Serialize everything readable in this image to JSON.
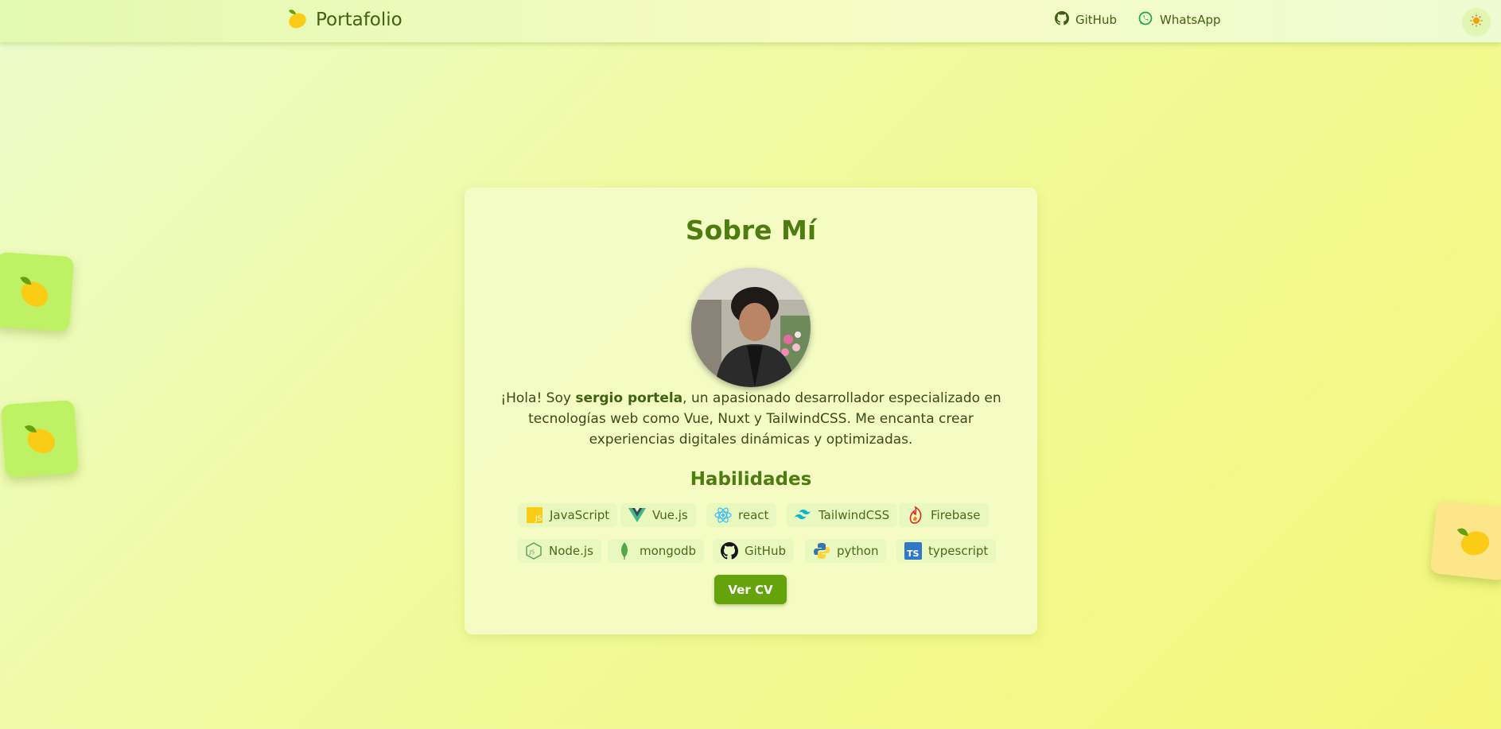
{
  "header": {
    "brand": "Portafolio",
    "brand_icon": "lemon-icon",
    "links": [
      {
        "label": "GitHub",
        "icon": "github-icon"
      },
      {
        "label": "WhatsApp",
        "icon": "whatsapp-icon"
      }
    ],
    "theme_icon": "sun-icon"
  },
  "about": {
    "title": "Sobre Mí",
    "intro_before": "¡Hola! Soy ",
    "name": "sergio portela",
    "intro_after": ", un apasionado desarrollador especializado en tecnologías web como Vue, Nuxt y TailwindCSS. Me encanta crear experiencias digitales dinámicas y optimizadas.",
    "skills_title": "Habilidades",
    "skills": [
      {
        "label": "JavaScript",
        "icon": "javascript-icon"
      },
      {
        "label": "Vue.js",
        "icon": "vue-icon"
      },
      {
        "label": "react",
        "icon": "react-icon"
      },
      {
        "label": "TailwindCSS",
        "icon": "tailwind-icon"
      },
      {
        "label": "Firebase",
        "icon": "firebase-icon"
      },
      {
        "label": "Node.js",
        "icon": "nodejs-icon"
      },
      {
        "label": "mongodb",
        "icon": "mongodb-icon"
      },
      {
        "label": "GitHub",
        "icon": "github-icon"
      },
      {
        "label": "python",
        "icon": "python-icon"
      },
      {
        "label": "typescript",
        "icon": "typescript-icon"
      }
    ],
    "cv_button": "Ver CV"
  },
  "colors": {
    "accent": "#65a30d",
    "heading": "#4d7c0f",
    "background": "#f1fa9c"
  }
}
